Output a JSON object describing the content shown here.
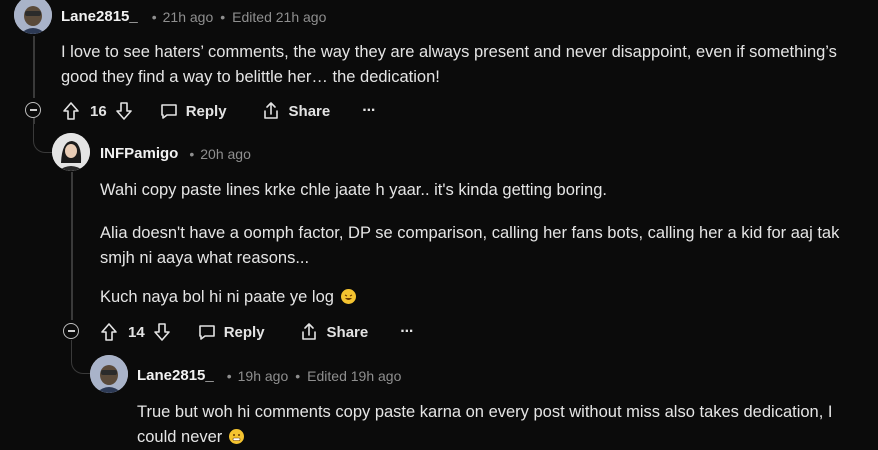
{
  "comments": [
    {
      "username": "Lane2815_",
      "time": "21h ago",
      "edited": "Edited 21h ago",
      "body": [
        "I love to see haters’ comments, the way they are always present and never disappoint, even if something’s good they find a way to belittle her… the dedication!"
      ],
      "votes": "16",
      "reply_label": "Reply",
      "share_label": "Share",
      "more_label": "···"
    },
    {
      "username": "INFPamigo",
      "time": "20h ago",
      "body": [
        "Wahi copy paste lines krke chle jaate h yaar.. it's kinda getting boring.",
        "Alia doesn't have a oomph factor, DP se comparison, calling her fans bots, calling her a kid for aaj tak smjh ni aaya what reasons...",
        "Kuch naya bol hi ni paate ye log"
      ],
      "votes": "14",
      "reply_label": "Reply",
      "share_label": "Share",
      "more_label": "···"
    },
    {
      "username": "Lane2815_",
      "time": "19h ago",
      "edited": "Edited 19h ago",
      "body": [
        "True but woh hi comments copy paste karna on every post without miss also takes dedication, I could never"
      ]
    }
  ],
  "separator": "•",
  "colors": {
    "background": "#0b0b0b",
    "text": "#e5e5e5",
    "muted": "#8f8f8f",
    "thread_line": "#3a3a3a"
  }
}
